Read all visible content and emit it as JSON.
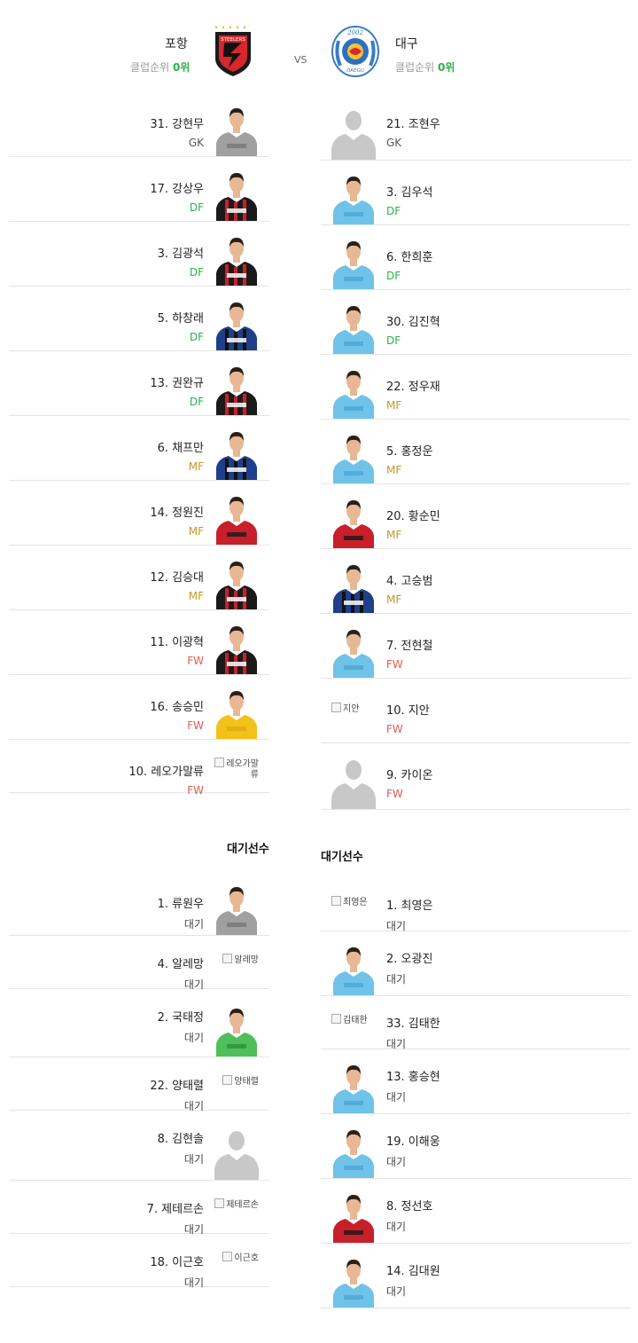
{
  "colors": {
    "GK": "#555555",
    "DF": "#2bb24c",
    "MF": "#c8962a",
    "FW": "#e05a50",
    "대기": "#444444",
    "rank_accent": "#2bb24c",
    "kit_pohang_a": "#1a1a1a",
    "kit_pohang_b": "#c8202a",
    "kit_daegu": "#6fc3e8",
    "kit_incheon": "#1f3f8a",
    "kit_gk": "#a0a0a0",
    "kit_yellow": "#f2c21a",
    "kit_green": "#4fbf5a",
    "kit_red": "#c8202a"
  },
  "header": {
    "home": {
      "name": "포항",
      "rank_label": "클럽순위",
      "rank_value": "0위",
      "crest_icon": "pohang-steelers-crest-icon",
      "crest_text": "STEELERS"
    },
    "vs": "VS",
    "away": {
      "name": "대구",
      "rank_label": "클럽순위",
      "rank_value": "0위",
      "crest_icon": "daegu-fc-crest-icon",
      "crest_text": "DAEGU",
      "crest_year": "2002"
    }
  },
  "home_starters": [
    {
      "name": "31. 강현무",
      "pos": "GK",
      "photo": "gk"
    },
    {
      "name": "17. 강상우",
      "pos": "DF",
      "photo": "pohang"
    },
    {
      "name": "3. 김광석",
      "pos": "DF",
      "photo": "pohang"
    },
    {
      "name": "5. 하창래",
      "pos": "DF",
      "photo": "incheon"
    },
    {
      "name": "13. 권완규",
      "pos": "DF",
      "photo": "pohang"
    },
    {
      "name": "6. 채프만",
      "pos": "MF",
      "photo": "incheon"
    },
    {
      "name": "14. 정원진",
      "pos": "MF",
      "photo": "red"
    },
    {
      "name": "12. 김승대",
      "pos": "MF",
      "photo": "pohang"
    },
    {
      "name": "11. 이광혁",
      "pos": "FW",
      "photo": "pohang"
    },
    {
      "name": "16. 송승민",
      "pos": "FW",
      "photo": "yellow"
    },
    {
      "name": "10. 레오가말류",
      "pos": "FW",
      "photo": "broken",
      "alt": "레오가말류"
    }
  ],
  "away_starters": [
    {
      "name": "21. 조현우",
      "pos": "GK",
      "photo": "silhouette"
    },
    {
      "name": "3. 김우석",
      "pos": "DF",
      "photo": "daegu"
    },
    {
      "name": "6. 한희훈",
      "pos": "DF",
      "photo": "daegu"
    },
    {
      "name": "30. 김진혁",
      "pos": "DF",
      "photo": "daegu"
    },
    {
      "name": "22. 정우재",
      "pos": "MF",
      "photo": "daegu"
    },
    {
      "name": "5. 홍정운",
      "pos": "MF",
      "photo": "daegu"
    },
    {
      "name": "20. 황순민",
      "pos": "MF",
      "photo": "red"
    },
    {
      "name": "4. 고승범",
      "pos": "MF",
      "photo": "incheon"
    },
    {
      "name": "7. 전현철",
      "pos": "FW",
      "photo": "daegu"
    },
    {
      "name": "10. 지안",
      "pos": "FW",
      "photo": "broken",
      "alt": "지안"
    },
    {
      "name": "9. 카이온",
      "pos": "FW",
      "photo": "silhouette"
    }
  ],
  "subs_title": "대기선수",
  "home_subs": [
    {
      "name": "1. 류원우",
      "pos": "대기",
      "photo": "gk"
    },
    {
      "name": "4. 알레망",
      "pos": "대기",
      "photo": "broken",
      "alt": "알레망"
    },
    {
      "name": "2. 국태정",
      "pos": "대기",
      "photo": "green"
    },
    {
      "name": "22. 양태렬",
      "pos": "대기",
      "photo": "broken",
      "alt": "양태렬"
    },
    {
      "name": "8. 김현솔",
      "pos": "대기",
      "photo": "silhouette"
    },
    {
      "name": "7. 제테르손",
      "pos": "대기",
      "photo": "broken",
      "alt": "제테르손"
    },
    {
      "name": "18. 이근호",
      "pos": "대기",
      "photo": "broken",
      "alt": "이근호"
    }
  ],
  "away_subs": [
    {
      "name": "1. 최영은",
      "pos": "대기",
      "photo": "broken",
      "alt": "최영은"
    },
    {
      "name": "2. 오광진",
      "pos": "대기",
      "photo": "daegu"
    },
    {
      "name": "33. 김태한",
      "pos": "대기",
      "photo": "broken",
      "alt": "김태한"
    },
    {
      "name": "13. 홍승현",
      "pos": "대기",
      "photo": "daegu"
    },
    {
      "name": "19. 이해웅",
      "pos": "대기",
      "photo": "daegu"
    },
    {
      "name": "8. 정선호",
      "pos": "대기",
      "photo": "red"
    },
    {
      "name": "14. 김대원",
      "pos": "대기",
      "photo": "daegu"
    }
  ]
}
